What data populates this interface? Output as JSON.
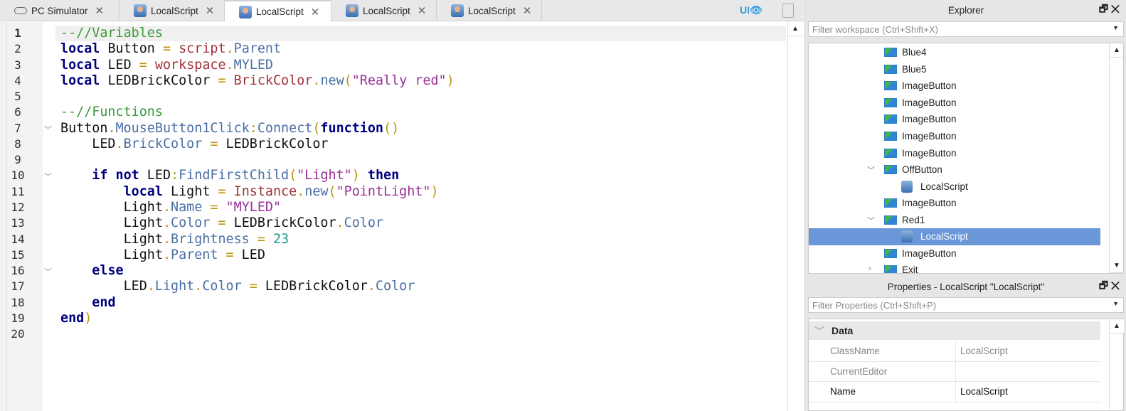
{
  "tabs": [
    {
      "label": "PC Simulator",
      "icon": "cloud-icon"
    },
    {
      "label": "LocalScript",
      "icon": "localscript-icon"
    },
    {
      "label": "LocalScript",
      "icon": "localscript-icon",
      "active": true
    },
    {
      "label": "LocalScript",
      "icon": "localscript-icon"
    },
    {
      "label": "LocalScript",
      "icon": "localscript-icon"
    }
  ],
  "toolbar": {
    "ui_label": "UI👁"
  },
  "editor": {
    "current_line": 1,
    "fold_lines": [
      7,
      10,
      16
    ],
    "lines": [
      [
        [
          "cm",
          "--//Variables"
        ]
      ],
      [
        [
          "kw",
          "local"
        ],
        [
          "id",
          " Button "
        ],
        [
          "op",
          "="
        ],
        [
          "id",
          " "
        ],
        [
          "glob",
          "script"
        ],
        [
          "op",
          "."
        ],
        [
          "prop",
          "Parent"
        ]
      ],
      [
        [
          "kw",
          "local"
        ],
        [
          "id",
          " LED "
        ],
        [
          "op",
          "="
        ],
        [
          "id",
          " "
        ],
        [
          "glob",
          "workspace"
        ],
        [
          "op",
          "."
        ],
        [
          "prop",
          "MYLED"
        ]
      ],
      [
        [
          "kw",
          "local"
        ],
        [
          "id",
          " LEDBrickColor "
        ],
        [
          "op",
          "="
        ],
        [
          "id",
          " "
        ],
        [
          "glob",
          "BrickColor"
        ],
        [
          "op",
          "."
        ],
        [
          "prop",
          "new"
        ],
        [
          "op",
          "("
        ],
        [
          "str",
          "\"Really red\""
        ],
        [
          "op",
          ")"
        ]
      ],
      [],
      [
        [
          "cm",
          "--//Functions"
        ]
      ],
      [
        [
          "id",
          "Button"
        ],
        [
          "op",
          "."
        ],
        [
          "prop",
          "MouseButton1Click"
        ],
        [
          "op",
          ":"
        ],
        [
          "prop",
          "Connect"
        ],
        [
          "op",
          "("
        ],
        [
          "kw",
          "function"
        ],
        [
          "op",
          "()"
        ]
      ],
      [
        [
          "id",
          "    LED"
        ],
        [
          "op",
          "."
        ],
        [
          "prop",
          "BrickColor"
        ],
        [
          "id",
          " "
        ],
        [
          "op",
          "="
        ],
        [
          "id",
          " LEDBrickColor"
        ]
      ],
      [],
      [
        [
          "id",
          "    "
        ],
        [
          "kw",
          "if not"
        ],
        [
          "id",
          " LED"
        ],
        [
          "op",
          ":"
        ],
        [
          "prop",
          "FindFirstChild"
        ],
        [
          "op",
          "("
        ],
        [
          "str",
          "\"Light\""
        ],
        [
          "op",
          ")"
        ],
        [
          "id",
          " "
        ],
        [
          "kw",
          "then"
        ]
      ],
      [
        [
          "id",
          "        "
        ],
        [
          "kw",
          "local"
        ],
        [
          "id",
          " Light "
        ],
        [
          "op",
          "="
        ],
        [
          "id",
          " "
        ],
        [
          "glob",
          "Instance"
        ],
        [
          "op",
          "."
        ],
        [
          "prop",
          "new"
        ],
        [
          "op",
          "("
        ],
        [
          "str",
          "\"PointLight\""
        ],
        [
          "op",
          ")"
        ]
      ],
      [
        [
          "id",
          "        Light"
        ],
        [
          "op",
          "."
        ],
        [
          "prop",
          "Name"
        ],
        [
          "id",
          " "
        ],
        [
          "op",
          "="
        ],
        [
          "id",
          " "
        ],
        [
          "str",
          "\"MYLED\""
        ]
      ],
      [
        [
          "id",
          "        Light"
        ],
        [
          "op",
          "."
        ],
        [
          "prop",
          "Color"
        ],
        [
          "id",
          " "
        ],
        [
          "op",
          "="
        ],
        [
          "id",
          " LEDBrickColor"
        ],
        [
          "op",
          "."
        ],
        [
          "prop",
          "Color"
        ]
      ],
      [
        [
          "id",
          "        Light"
        ],
        [
          "op",
          "."
        ],
        [
          "prop",
          "Brightness"
        ],
        [
          "id",
          " "
        ],
        [
          "op",
          "="
        ],
        [
          "id",
          " "
        ],
        [
          "num",
          "23"
        ]
      ],
      [
        [
          "id",
          "        Light"
        ],
        [
          "op",
          "."
        ],
        [
          "prop",
          "Parent"
        ],
        [
          "id",
          " "
        ],
        [
          "op",
          "="
        ],
        [
          "id",
          " LED"
        ]
      ],
      [
        [
          "id",
          "    "
        ],
        [
          "kw",
          "else"
        ]
      ],
      [
        [
          "id",
          "        LED"
        ],
        [
          "op",
          "."
        ],
        [
          "prop",
          "Light"
        ],
        [
          "op",
          "."
        ],
        [
          "prop",
          "Color"
        ],
        [
          "id",
          " "
        ],
        [
          "op",
          "="
        ],
        [
          "id",
          " LEDBrickColor"
        ],
        [
          "op",
          "."
        ],
        [
          "prop",
          "Color"
        ]
      ],
      [
        [
          "id",
          "    "
        ],
        [
          "kw",
          "end"
        ]
      ],
      [
        [
          "kw",
          "end"
        ],
        [
          "op",
          ")"
        ]
      ],
      []
    ]
  },
  "explorer": {
    "title": "Explorer",
    "filter_placeholder": "Filter workspace (Ctrl+Shift+X)",
    "items": [
      {
        "label": "Blue4",
        "icon": "image-icon",
        "level": 0
      },
      {
        "label": "Blue5",
        "icon": "image-icon",
        "level": 0
      },
      {
        "label": "ImageButton",
        "icon": "image-icon",
        "level": 0
      },
      {
        "label": "ImageButton",
        "icon": "image-icon",
        "level": 0
      },
      {
        "label": "ImageButton",
        "icon": "image-icon",
        "level": 0
      },
      {
        "label": "ImageButton",
        "icon": "image-icon",
        "level": 0
      },
      {
        "label": "ImageButton",
        "icon": "image-icon",
        "level": 0
      },
      {
        "label": "OffButton",
        "icon": "image-icon",
        "level": 0,
        "expanded": true
      },
      {
        "label": "LocalScript",
        "icon": "localscript-icon",
        "level": 1
      },
      {
        "label": "ImageButton",
        "icon": "image-icon",
        "level": 0
      },
      {
        "label": "Red1",
        "icon": "image-icon",
        "level": 0,
        "expanded": true
      },
      {
        "label": "LocalScript",
        "icon": "localscript-icon",
        "level": 1,
        "selected": true
      },
      {
        "label": "ImageButton",
        "icon": "image-icon",
        "level": 0
      },
      {
        "label": "Exit",
        "icon": "image-icon",
        "level": 0,
        "collapsed": true
      }
    ]
  },
  "properties": {
    "title": "Properties - LocalScript \"LocalScript\"",
    "filter_placeholder": "Filter Properties (Ctrl+Shift+P)",
    "section": "Data",
    "rows": [
      {
        "name": "ClassName",
        "value": "LocalScript"
      },
      {
        "name": "CurrentEditor",
        "value": ""
      },
      {
        "name": "Name",
        "value": "LocalScript",
        "editable": true
      }
    ]
  }
}
